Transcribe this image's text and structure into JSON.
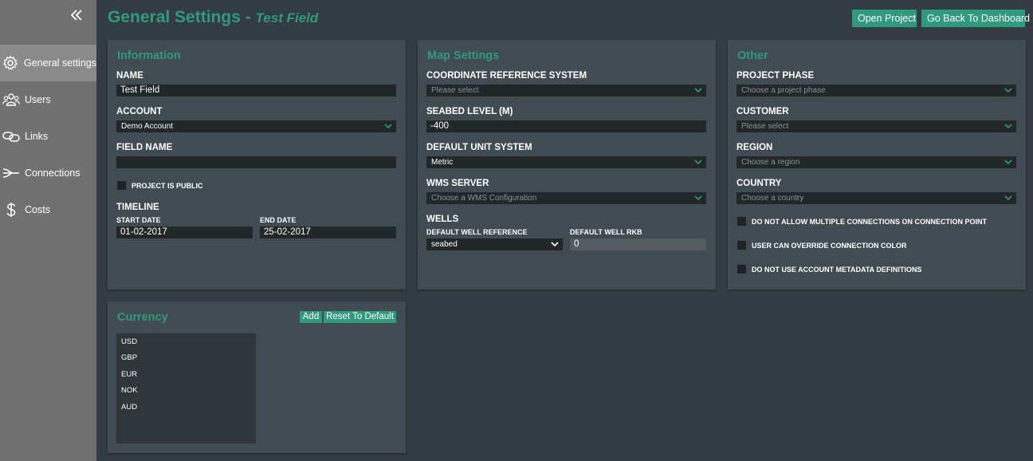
{
  "sidebar": {
    "items": [
      {
        "label": "General settings",
        "icon": "gear-icon"
      },
      {
        "label": "Users",
        "icon": "users-icon"
      },
      {
        "label": "Links",
        "icon": "link-icon"
      },
      {
        "label": "Connections",
        "icon": "connections-icon"
      },
      {
        "label": "Costs",
        "icon": "dollar-icon"
      }
    ]
  },
  "header": {
    "title": "General Settings - ",
    "subtitle": "Test Field",
    "open_project": "Open Project",
    "back_dashboard": "Go Back To Dashboard"
  },
  "information": {
    "title": "Information",
    "name_label": "NAME",
    "name_value": "Test Field",
    "account_label": "ACCOUNT",
    "account_value": "Demo Account",
    "field_name_label": "FIELD NAME",
    "field_name_value": "",
    "public_label": "PROJECT IS PUBLIC",
    "timeline_label": "TIMELINE",
    "start_label": "START DATE",
    "start_value": "01-02-2017",
    "end_label": "END DATE",
    "end_value": "25-02-2017"
  },
  "map": {
    "title": "Map Settings",
    "crs_label": "COORDINATE REFERENCE SYSTEM",
    "crs_placeholder": "Please select",
    "seabed_label": "SEABED LEVEL (M)",
    "seabed_value": "-400",
    "unit_label": "DEFAULT UNIT SYSTEM",
    "unit_value": "Metric",
    "wms_label": "WMS SERVER",
    "wms_placeholder": "Choose a WMS Configuration",
    "wells_label": "WELLS",
    "well_ref_label": "DEFAULT WELL REFERENCE",
    "well_ref_value": "seabed",
    "well_rkb_label": "DEFAULT WELL RKB",
    "well_rkb_value": "0"
  },
  "other": {
    "title": "Other",
    "phase_label": "PROJECT PHASE",
    "phase_placeholder": "Choose a project phase",
    "customer_label": "CUSTOMER",
    "customer_placeholder": "Please select",
    "region_label": "REGION",
    "region_placeholder": "Choose a region",
    "country_label": "COUNTRY",
    "country_placeholder": "Choose a country",
    "check1": "DO NOT ALLOW MULTIPLE CONNECTIONS ON CONNECTION POINT",
    "check2": "USER CAN OVERRIDE CONNECTION COLOR",
    "check3": "DO NOT USE ACCOUNT METADATA DEFINITIONS"
  },
  "currency": {
    "title": "Currency",
    "add": "Add",
    "reset": "Reset To Default",
    "items": [
      "USD",
      "GBP",
      "EUR",
      "NOK",
      "AUD"
    ]
  },
  "colors": {
    "accent": "#2f9a7c",
    "background": "#343c43",
    "panel": "#414b52",
    "sidebar": "#717171"
  }
}
